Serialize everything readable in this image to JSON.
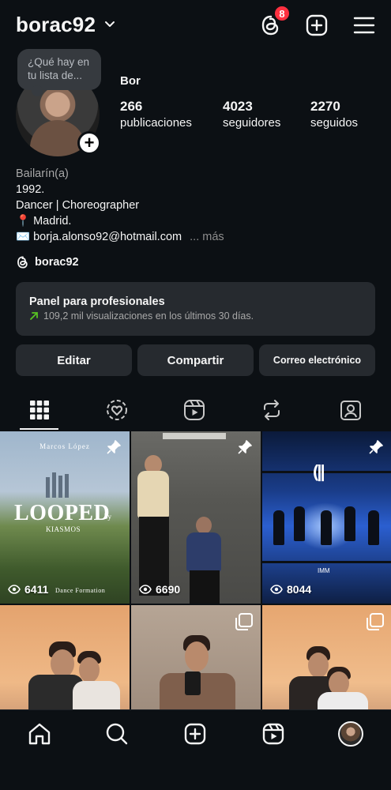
{
  "header": {
    "username": "borac92",
    "threads_badge_count": "8"
  },
  "profile": {
    "note": "¿Qué hay en tu lista de...",
    "display_name": "Bor",
    "stats": [
      {
        "value": "266",
        "label": "publicaciones"
      },
      {
        "value": "4023",
        "label": "seguidores"
      },
      {
        "value": "2270",
        "label": "seguidos"
      }
    ],
    "bio": {
      "category": "Bailarín(a)",
      "line1": "1992.",
      "line2": "Dancer | Choreographer",
      "location_emoji": "📍",
      "location": "Madrid.",
      "mail_emoji": "✉️",
      "email": "borja.alonso92@hotmail.com",
      "more": "... más"
    },
    "threads_handle": "borac92"
  },
  "dashboard": {
    "title": "Panel para profesionales",
    "subtitle": "109,2 mil visualizaciones en los últimos 30 días."
  },
  "actions": {
    "edit": "Editar",
    "share": "Compartir",
    "email": "Correo electrónico"
  },
  "tabs": [
    "grid-icon",
    "tagged-stories-icon",
    "reels-icon",
    "reposts-icon",
    "tagged-icon"
  ],
  "grid": {
    "posts": [
      {
        "views": "6411",
        "pinned": true,
        "brand": "Marcos López",
        "title": "LOOPED",
        "by": "by",
        "artist": "KIASMOS",
        "footer": "Dance Formation"
      },
      {
        "views": "6690",
        "pinned": true
      },
      {
        "views": "8044",
        "pinned": true,
        "watermark": "IMM"
      },
      {
        "carousel": false
      },
      {
        "carousel": true
      },
      {
        "carousel": true
      }
    ]
  },
  "bottom_nav": [
    "home-icon",
    "search-icon",
    "create-icon",
    "reels-icon",
    "profile-avatar"
  ]
}
